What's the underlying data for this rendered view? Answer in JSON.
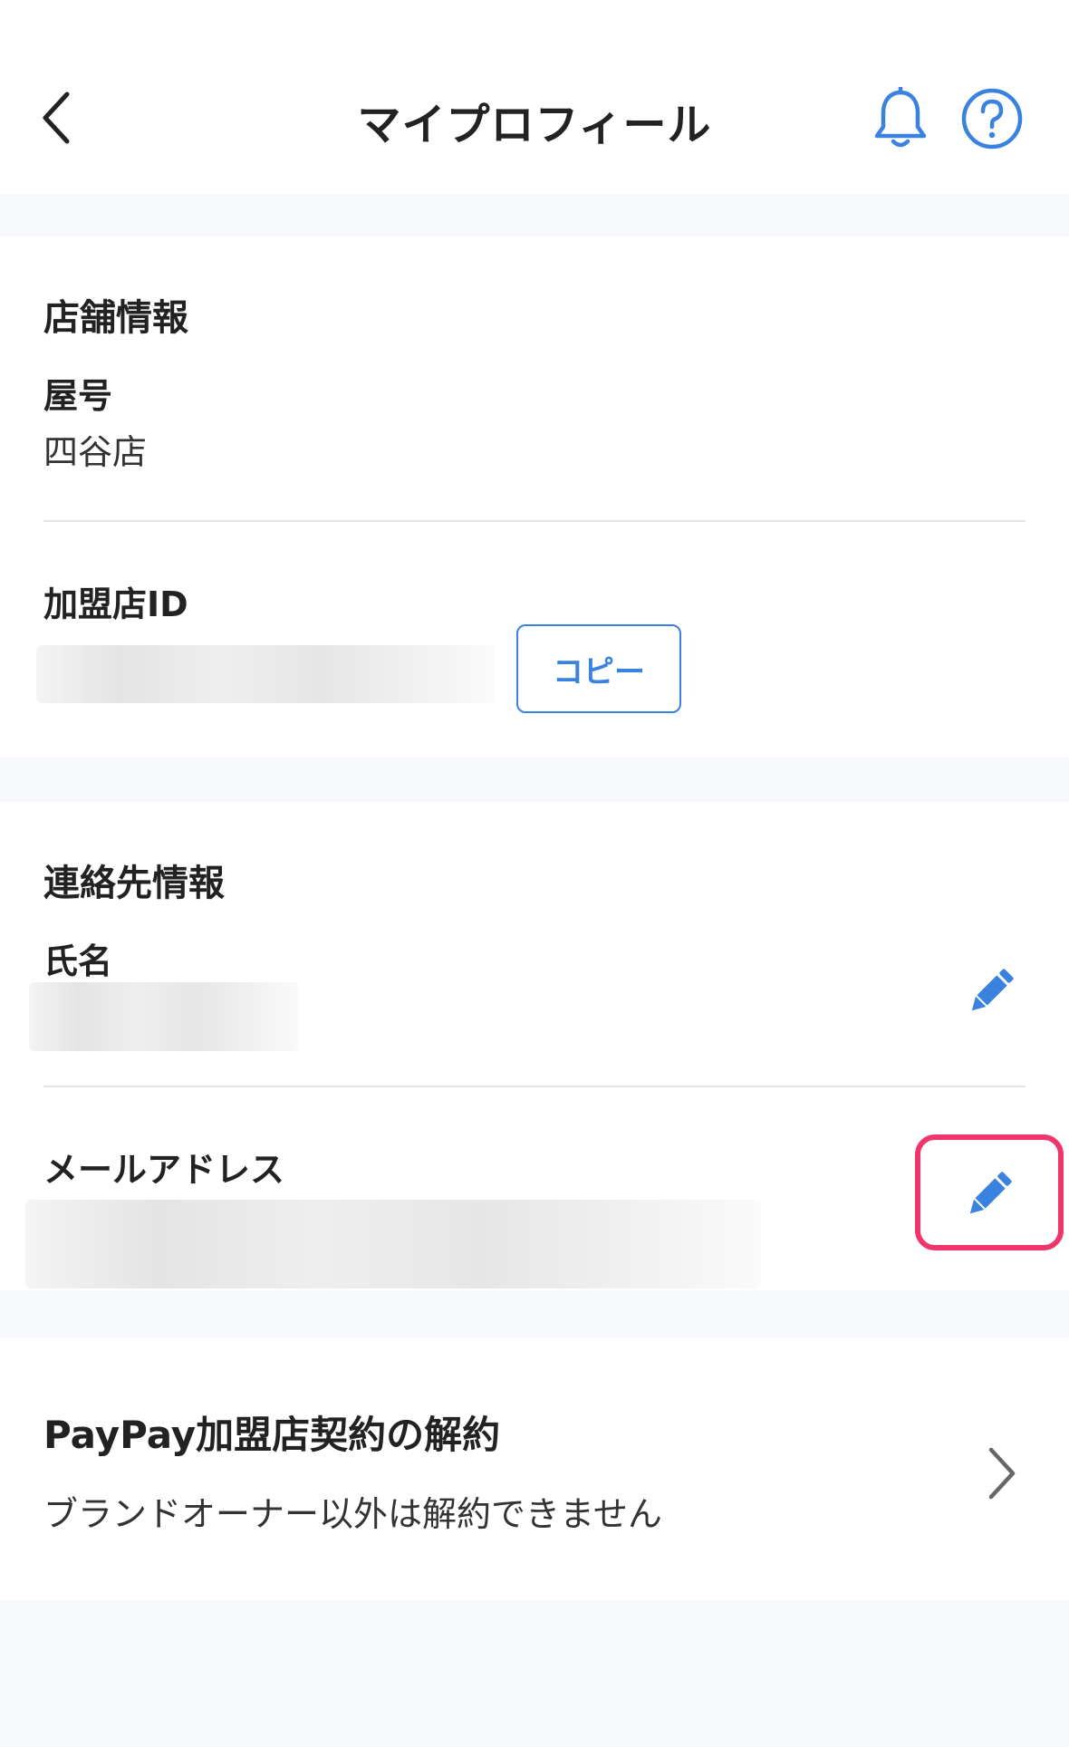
{
  "header": {
    "title": "マイプロフィール"
  },
  "store_info": {
    "section_title": "店舗情報",
    "shop_name_label": "屋号",
    "shop_name_value": "四谷店",
    "merchant_id_label": "加盟店ID",
    "copy_button": "コピー"
  },
  "contact_info": {
    "section_title": "連絡先情報",
    "name_label": "氏名",
    "email_label": "メールアドレス"
  },
  "cancel_contract": {
    "title": "PayPay加盟店契約の解約",
    "description": "ブランドオーナー以外は解約できません"
  },
  "colors": {
    "accent": "#3a82e0",
    "highlight": "#f0356b",
    "background": "#f6f8fc"
  },
  "icons": [
    "chevron-left-icon",
    "bell-icon",
    "help-icon",
    "pencil-icon",
    "chevron-right-icon"
  ]
}
